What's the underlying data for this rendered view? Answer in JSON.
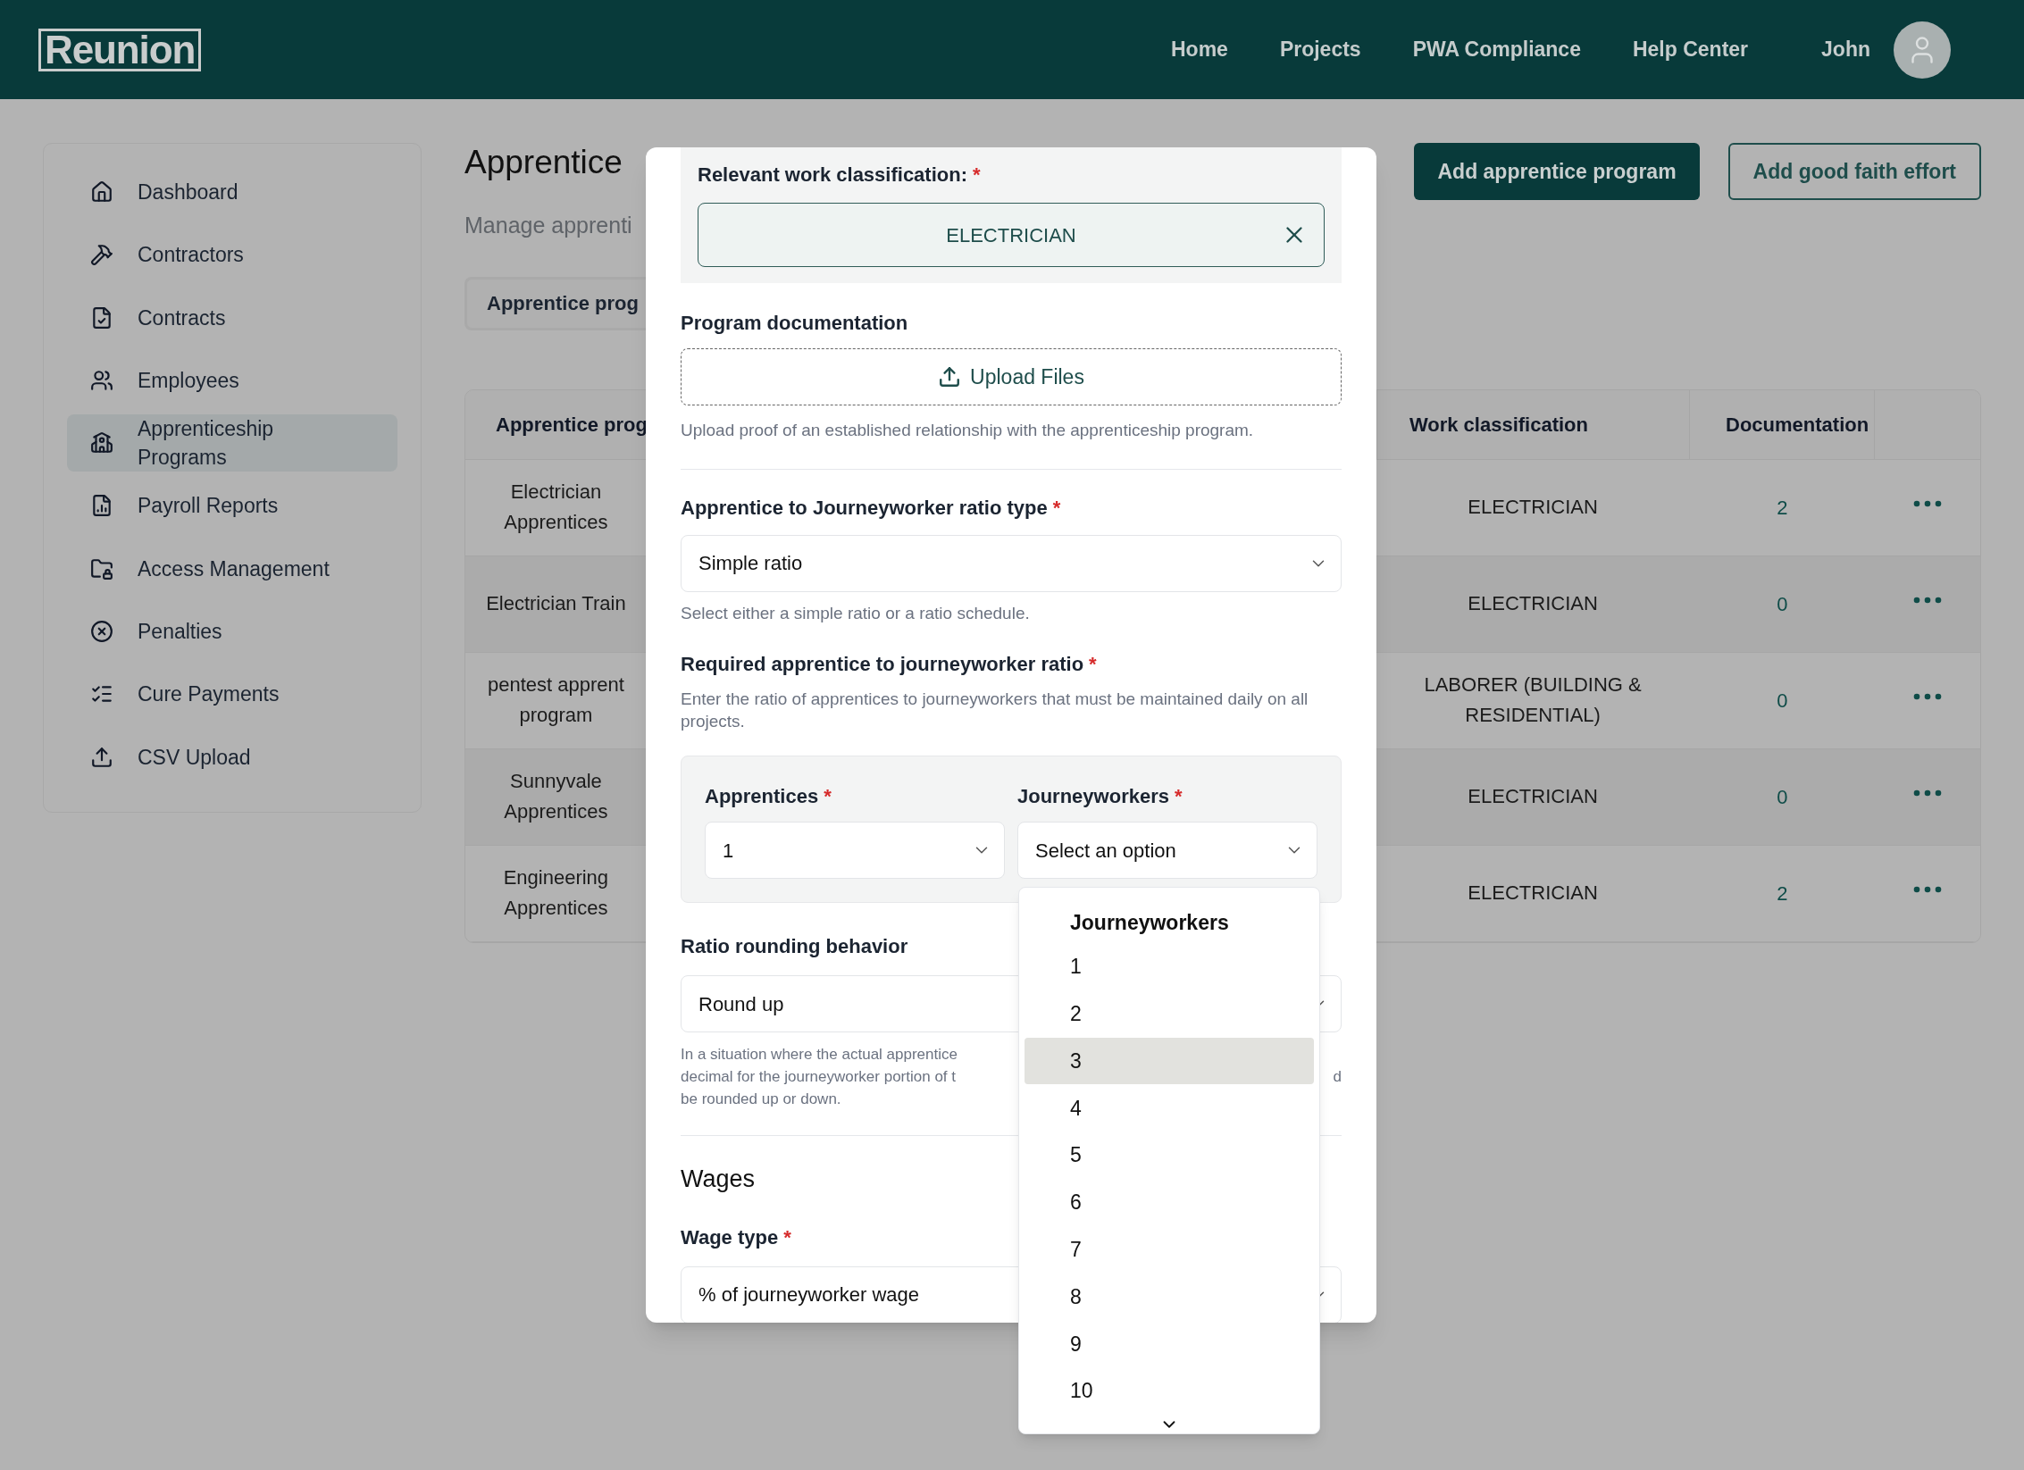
{
  "header": {
    "logo": "Reunion",
    "nav": [
      {
        "label": "Home"
      },
      {
        "label": "Projects"
      },
      {
        "label": "PWA Compliance"
      },
      {
        "label": "Help Center"
      }
    ],
    "user": "John"
  },
  "sidebar": {
    "items": [
      {
        "label": "Dashboard",
        "selected": false
      },
      {
        "label": "Contractors",
        "selected": false
      },
      {
        "label": "Contracts",
        "selected": false
      },
      {
        "label": "Employees",
        "selected": false
      },
      {
        "label": "Apprenticeship Programs",
        "selected": true
      },
      {
        "label": "Payroll Reports",
        "selected": false
      },
      {
        "label": "Access Management",
        "selected": false
      },
      {
        "label": "Penalties",
        "selected": false
      },
      {
        "label": "Cure Payments",
        "selected": false
      },
      {
        "label": "CSV Upload",
        "selected": false
      }
    ]
  },
  "page": {
    "title": "Apprentice",
    "subtitle": "Manage apprenti",
    "tab": "Apprentice prog",
    "buttons": [
      {
        "label": "Add apprentice program",
        "kind": "primary"
      },
      {
        "label": "Add good faith effort",
        "kind": "outline"
      }
    ]
  },
  "table": {
    "columns": [
      "Apprentice prog",
      "Work classification",
      "Documentation"
    ],
    "rows": [
      {
        "name": "Electrician Apprentices",
        "work_classification": "ELECTRICIAN",
        "documentation": "2"
      },
      {
        "name": "Electrician Train",
        "work_classification": "ELECTRICIAN",
        "documentation": "0"
      },
      {
        "name": "pentest apprent program",
        "work_classification": "LABORER (BUILDING & RESIDENTIAL)",
        "documentation": "0"
      },
      {
        "name": "Sunnyvale Apprentices",
        "work_classification": "ELECTRICIAN",
        "documentation": "0"
      },
      {
        "name": "Engineering Apprentices",
        "work_classification": "ELECTRICIAN",
        "documentation": "2"
      }
    ]
  },
  "modal": {
    "work_classification": {
      "label": "Relevant work classification:",
      "required_mark": "*",
      "value": "ELECTRICIAN"
    },
    "documentation": {
      "label": "Program documentation",
      "button": "Upload Files",
      "hint": "Upload proof of an established relationship with the apprenticeship program."
    },
    "ratio_type": {
      "label": "Apprentice to Journeyworker ratio type",
      "required_mark": "*",
      "value": "Simple ratio",
      "hint": "Select either a simple ratio or a ratio schedule."
    },
    "ratio": {
      "label": "Required apprentice to journeyworker ratio",
      "required_mark": "*",
      "hint": "Enter the ratio of apprentices to journeyworkers that must be maintained daily on all projects.",
      "apprentices": {
        "label": "Apprentices",
        "required_mark": "*",
        "value": "1"
      },
      "journeyworkers": {
        "label": "Journeyworkers",
        "required_mark": "*",
        "placeholder": "Select an option"
      }
    },
    "rounding": {
      "label": "Ratio rounding behavior",
      "value": "Round up",
      "hint_lines": [
        {
          "left": "In a situation where the actual apprentice"
        },
        {
          "left": "decimal for the journeyworker portion of t",
          "right": "d"
        },
        {
          "left": "be rounded up or down."
        }
      ]
    },
    "wages": {
      "heading": "Wages",
      "wage_type": {
        "label": "Wage type",
        "required_mark": "*",
        "value": "% of journeyworker wage"
      }
    }
  },
  "dropdown": {
    "heading": "Journeyworkers",
    "options": [
      {
        "label": "1",
        "highlighted": false
      },
      {
        "label": "2",
        "highlighted": false
      },
      {
        "label": "3",
        "highlighted": true
      },
      {
        "label": "4",
        "highlighted": false
      },
      {
        "label": "5",
        "highlighted": false
      },
      {
        "label": "6",
        "highlighted": false
      },
      {
        "label": "7",
        "highlighted": false
      },
      {
        "label": "8",
        "highlighted": false
      },
      {
        "label": "9",
        "highlighted": false
      },
      {
        "label": "10",
        "highlighted": false
      }
    ]
  }
}
